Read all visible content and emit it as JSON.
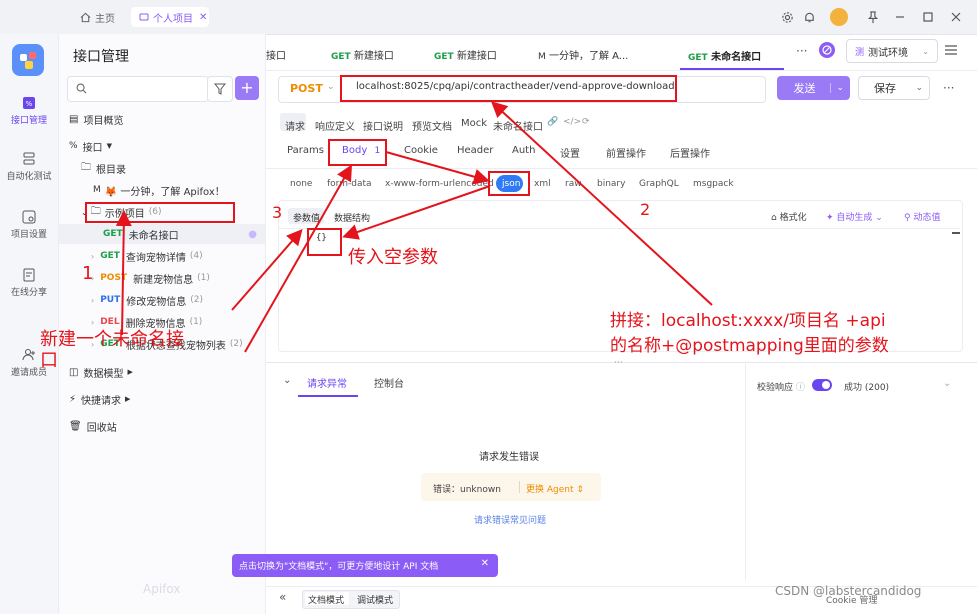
{
  "window": {
    "home_tab": "主页",
    "project_tab": "个人项目"
  },
  "rail": {
    "items": [
      {
        "label": "接口管理"
      },
      {
        "label": "自动化测试"
      },
      {
        "label": "项目设置"
      },
      {
        "label": "在线分享"
      },
      {
        "label": "邀请成员"
      }
    ]
  },
  "sidebar": {
    "title": "接口管理",
    "overview": "项目概览",
    "api_group": "接口",
    "root": "根目录",
    "intro_item": "🦊 一分钟，了解 Apifox！",
    "folder": {
      "name": "示例项目",
      "count": "(6)"
    },
    "endpoints": [
      {
        "method": "GET",
        "name": "未命名接口",
        "count": ""
      },
      {
        "method": "GET",
        "name": "查询宠物详情",
        "count": "(4)"
      },
      {
        "method": "POST",
        "name": "新建宠物信息",
        "count": "(1)"
      },
      {
        "method": "PUT",
        "name": "修改宠物信息",
        "count": "(2)"
      },
      {
        "method": "DEL",
        "name": "删除宠物信息",
        "count": "(1)"
      },
      {
        "method": "GET",
        "name": "根据状态查找宠物列表",
        "count": "(2)"
      }
    ],
    "data_model": "数据模型",
    "quick_request": "快捷请求",
    "recycle": "回收站",
    "watermark": "Apifox"
  },
  "tabs": {
    "items": [
      {
        "method": "",
        "label": "接口"
      },
      {
        "method": "GET",
        "label": "新建接口"
      },
      {
        "method": "GET",
        "label": "新建接口"
      },
      {
        "method": "M",
        "label": "一分钟，了解 A..."
      },
      {
        "method": "GET",
        "label": "未命名接口"
      }
    ],
    "more": "···",
    "env": "测试环境"
  },
  "request": {
    "method": "POST",
    "url": "localhost:8025/cpq/api/contractheader/vend-approve-download",
    "send": "发送",
    "save": "保存"
  },
  "feature_tabs": [
    "请求",
    "响应定义",
    "接口说明",
    "预览文档",
    "Mock",
    "未命名接口"
  ],
  "sub_tabs": [
    {
      "label": "Params",
      "count": ""
    },
    {
      "label": "Body",
      "count": "1"
    },
    {
      "label": "Cookie",
      "count": ""
    },
    {
      "label": "Header",
      "count": ""
    },
    {
      "label": "Auth",
      "count": ""
    },
    {
      "label": "设置",
      "count": ""
    },
    {
      "label": "前置操作",
      "count": ""
    },
    {
      "label": "后置操作",
      "count": ""
    }
  ],
  "body_types": [
    "none",
    "form-data",
    "x-www-form-urlencoded",
    "json",
    "xml",
    "raw",
    "binary",
    "GraphQL",
    "msgpack"
  ],
  "editor": {
    "tabs": [
      "参数值",
      "数据结构"
    ],
    "format_btn": "格式化",
    "autogen_btn": "自动生成",
    "dynamic_btn": "动态值",
    "line_no": "1",
    "code": "{}"
  },
  "response": {
    "tabs": [
      "请求异常",
      "控制台"
    ],
    "validate_label": "校验响应",
    "success_label": "成功 (200)",
    "error_title": "请求发生错误",
    "error_label": "错误：unknown",
    "switch_agent": "更换 Agent",
    "faq_link": "请求错误常见问题"
  },
  "toast": {
    "text": "点击切换为\"文档模式\"，可更方便地设计 API 文档"
  },
  "footer": {
    "doc_mode": "文档模式",
    "debug_mode": "调试模式",
    "cookie_mgr": "Cookie 管理",
    "watermark": "CSDN @labstercandidog"
  },
  "annotations": {
    "n1": "1",
    "n2": "2",
    "n3": "3",
    "text_new_api": "新建一个未命名接口",
    "text_empty_param": "传入空参数",
    "text_concat_l1": "拼接：localhost:xxxx/项目名 +api",
    "text_concat_l2": "的名称+@postmapping里面的参数"
  },
  "colors": {
    "accent": "#6b46f0",
    "send_button": "#9a7bf5",
    "annotation": "#e3141b",
    "get": "#1e9e4a",
    "post": "#f08c00",
    "put": "#2f6fe8",
    "del": "#e5484d"
  }
}
